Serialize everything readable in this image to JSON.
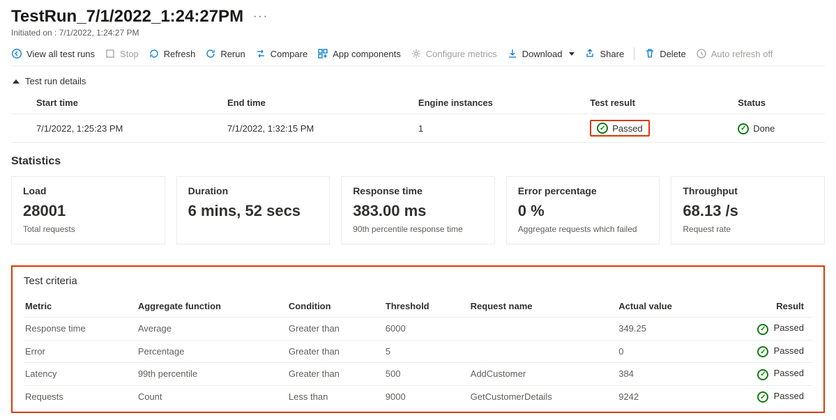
{
  "header": {
    "title": "TestRun_7/1/2022_1:24:27PM",
    "subtitle": "Initiated on : 7/1/2022, 1:24:27 PM"
  },
  "toolbar": {
    "view_all": "View all test runs",
    "stop": "Stop",
    "refresh": "Refresh",
    "rerun": "Rerun",
    "compare": "Compare",
    "app_components": "App components",
    "configure_metrics": "Configure metrics",
    "download": "Download",
    "share": "Share",
    "delete": "Delete",
    "auto_refresh": "Auto refresh off"
  },
  "details": {
    "section_label": "Test run details",
    "headers": {
      "start": "Start time",
      "end": "End time",
      "engine": "Engine instances",
      "result": "Test result",
      "status": "Status"
    },
    "row": {
      "start": "7/1/2022, 1:25:23 PM",
      "end": "7/1/2022, 1:32:15 PM",
      "engine": "1",
      "result": "Passed",
      "status": "Done"
    }
  },
  "statistics": {
    "heading": "Statistics",
    "cards": [
      {
        "label": "Load",
        "value": "28001",
        "desc": "Total requests"
      },
      {
        "label": "Duration",
        "value": "6 mins, 52 secs",
        "desc": ""
      },
      {
        "label": "Response time",
        "value": "383.00 ms",
        "desc": "90th percentile response time"
      },
      {
        "label": "Error percentage",
        "value": "0 %",
        "desc": "Aggregate requests which failed"
      },
      {
        "label": "Throughput",
        "value": "68.13 /s",
        "desc": "Request rate"
      }
    ]
  },
  "criteria": {
    "heading": "Test criteria",
    "headers": {
      "metric": "Metric",
      "aggregate": "Aggregate function",
      "condition": "Condition",
      "threshold": "Threshold",
      "request": "Request name",
      "actual": "Actual value",
      "result": "Result"
    },
    "rows": [
      {
        "metric": "Response time",
        "aggregate": "Average",
        "condition": "Greater than",
        "threshold": "6000",
        "request": "",
        "actual": "349.25",
        "result": "Passed"
      },
      {
        "metric": "Error",
        "aggregate": "Percentage",
        "condition": "Greater than",
        "threshold": "5",
        "request": "",
        "actual": "0",
        "result": "Passed"
      },
      {
        "metric": "Latency",
        "aggregate": "99th percentile",
        "condition": "Greater than",
        "threshold": "500",
        "request": "AddCustomer",
        "actual": "384",
        "result": "Passed"
      },
      {
        "metric": "Requests",
        "aggregate": "Count",
        "condition": "Less than",
        "threshold": "9000",
        "request": "GetCustomerDetails",
        "actual": "9242",
        "result": "Passed"
      }
    ]
  }
}
